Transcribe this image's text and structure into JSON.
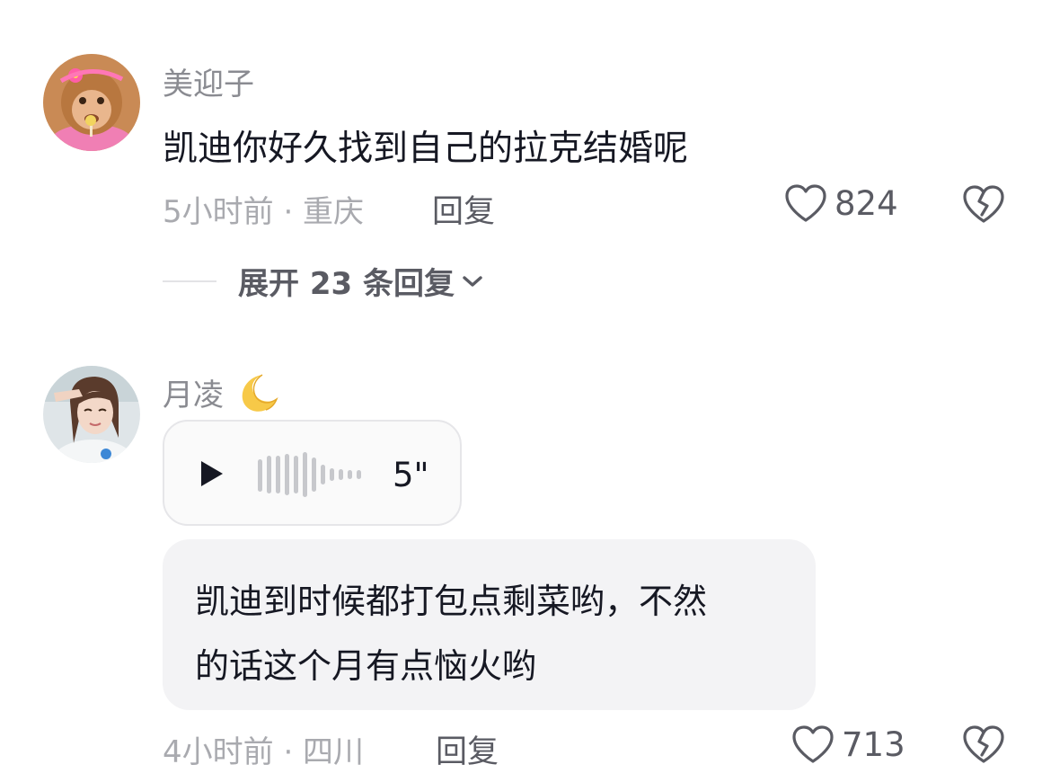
{
  "comments": [
    {
      "username": "美迎子",
      "text": "凯迪你好久找到自己的拉克结婚呢",
      "meta": "5小时前 · 重庆",
      "reply_label": "回复",
      "likes": "824",
      "expand_label": "展开 23 条回复",
      "avatar_icon": "monkey-avatar"
    },
    {
      "username": "月凌",
      "username_emoji": "🌙",
      "voice_duration": "5\"",
      "bubble_line1": "凯迪到时候都打包点剩菜哟，不然",
      "bubble_line2": "的话这个月有点恼火哟",
      "meta": "4小时前 · 四川",
      "reply_label": "回复",
      "likes": "713",
      "avatar_icon": "girl-avatar"
    }
  ],
  "colors": {
    "text_primary": "#161823",
    "text_secondary": "#8a8b91",
    "text_meta": "#a9aaaf",
    "bubble_bg": "#f3f3f5",
    "voice_border": "#e6e6e9"
  },
  "icons": [
    "heart-icon",
    "broken-heart-icon",
    "play-icon",
    "waveform-icon",
    "chevron-down-icon",
    "crescent-moon-icon"
  ]
}
